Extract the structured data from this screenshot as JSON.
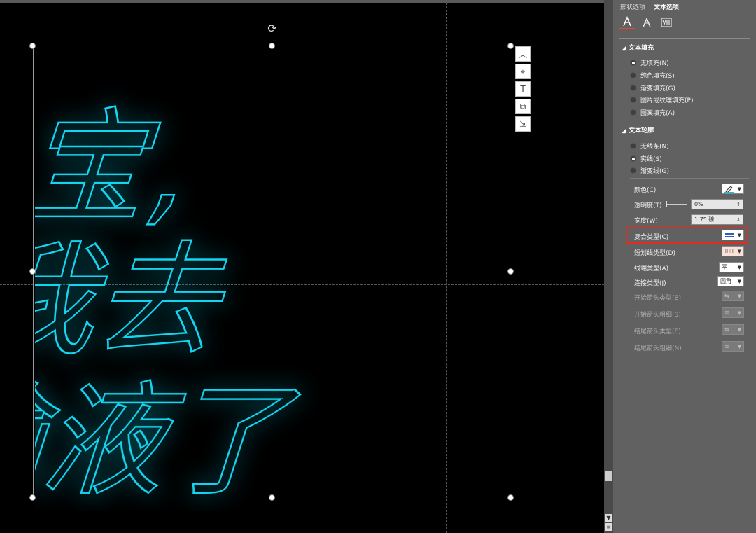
{
  "canvas": {
    "art_lines": [
      "宝,",
      "我去",
      "输液了"
    ],
    "neon_color": "#19d3f0",
    "glow_color": "#0a6d80",
    "rotate_icon": "rotate-icon"
  },
  "float_tools": [
    {
      "name": "layout-options-icon",
      "glyph": "︿"
    },
    {
      "name": "position-icon",
      "glyph": "⌖"
    },
    {
      "name": "text-box-icon",
      "glyph": "T"
    },
    {
      "name": "copy-format-icon",
      "glyph": "⧉"
    },
    {
      "name": "resize-icon",
      "glyph": "⇲"
    }
  ],
  "panel": {
    "tabs": {
      "shape": "形状选项",
      "text": "文本选项"
    },
    "icon_tabs": [
      {
        "name": "text-fill-outline-icon",
        "glyph": "A"
      },
      {
        "name": "text-effects-icon",
        "glyph": "A"
      },
      {
        "name": "textbox-icon",
        "glyph": "☰"
      }
    ],
    "fill": {
      "title": "文本填充",
      "options": [
        "无填充(N)",
        "纯色填充(S)",
        "渐变填充(G)",
        "图片或纹理填充(P)",
        "图案填充(A)"
      ],
      "selected": 0
    },
    "outline": {
      "title": "文本轮廓",
      "options": [
        "无线条(N)",
        "实线(S)",
        "渐变线(G)"
      ],
      "selected": 1
    },
    "props": {
      "color_label": "颜色(C)",
      "transparency_label": "透明度(T)",
      "transparency_value": "0%",
      "width_label": "宽度(W)",
      "width_value": "1.75 磅",
      "compound_label": "复合类型(C)",
      "dash_label": "短划线类型(D)",
      "cap_label": "线端类型(A)",
      "cap_value": "平",
      "join_label": "连接类型(J)",
      "join_value": "圆角",
      "begin_arrow_type_label": "开始箭头类型(B)",
      "begin_arrow_size_label": "开始箭头粗细(S)",
      "end_arrow_type_label": "结尾箭头类型(E)",
      "end_arrow_size_label": "结尾箭头粗细(N)"
    },
    "accent_color": "#e02c1e",
    "outline_swatch": "#19bfe0"
  }
}
